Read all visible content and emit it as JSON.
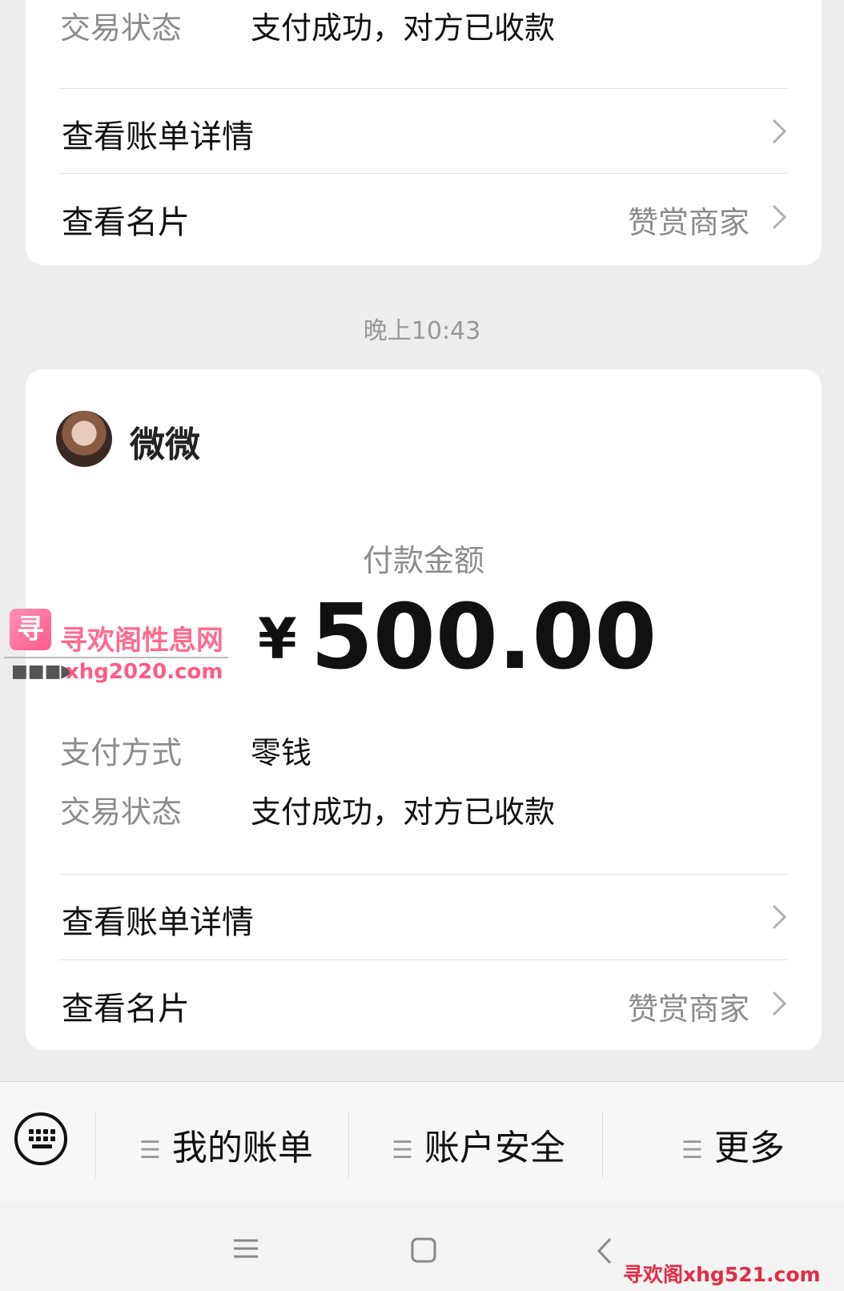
{
  "top_card": {
    "status_label": "交易状态",
    "status_value": "支付成功，对方已收款",
    "bill_detail": "查看账单详情",
    "view_card": "查看名片",
    "merchant": "赞赏商家"
  },
  "timestamp": "晚上10:43",
  "main_card": {
    "payer_name": "微微",
    "amount_title": "付款金额",
    "currency": "¥",
    "amount": "500.00",
    "method_label": "支付方式",
    "method_value": "零钱",
    "status_label": "交易状态",
    "status_value": "支付成功，对方已收款",
    "bill_detail": "查看账单详情",
    "view_card": "查看名片",
    "merchant": "赞赏商家"
  },
  "bottom_menu": {
    "items": [
      "我的账单",
      "账户安全",
      "更多"
    ]
  },
  "watermark": {
    "logo_char": "寻",
    "title": "寻欢阁性息网",
    "url": "xhg2020.com",
    "arrow": "■■■▶",
    "bottom": "寻欢阁xhg521.com"
  },
  "colors": {
    "background": "#ededed",
    "card": "#ffffff",
    "muted_text": "#8c8c8c",
    "watermark": "#ff5a84"
  }
}
